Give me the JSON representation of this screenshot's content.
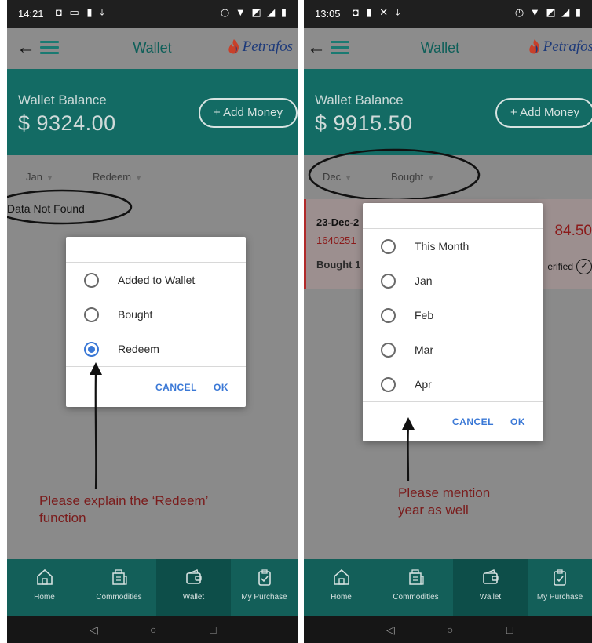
{
  "left": {
    "status": {
      "time": "14:21",
      "icons_left": "◘ ▭ ▮ ⤓",
      "icons_right": "◷ ▼ ◩ ◢ ▮"
    },
    "header": {
      "title": "Wallet",
      "logo": "Petrafos"
    },
    "balance": {
      "label": "Wallet Balance",
      "amount": "$ 9324.00",
      "add_money": "+ Add Money"
    },
    "filters": {
      "month": "Jan",
      "type": "Redeem"
    },
    "empty_message": "Data Not Found",
    "dialog": {
      "options": [
        {
          "label": "Added to Wallet",
          "selected": false
        },
        {
          "label": "Bought",
          "selected": false
        },
        {
          "label": "Redeem",
          "selected": true
        }
      ],
      "cancel": "CANCEL",
      "ok": "OK"
    },
    "note": [
      "Please explain the ‘Redeem’",
      "function"
    ],
    "nav": [
      {
        "label": "Home",
        "icon": "home-icon",
        "active": false
      },
      {
        "label": "Commodities",
        "icon": "commodities-icon",
        "active": false
      },
      {
        "label": "Wallet",
        "icon": "wallet-icon",
        "active": true
      },
      {
        "label": "My Purchase",
        "icon": "clipboard-icon",
        "active": false
      }
    ]
  },
  "right": {
    "status": {
      "time": "13:05",
      "icons_left": "◘ ▮ ✕ ⤓",
      "icons_right": "◷ ▼ ◩ ◢ ▮"
    },
    "header": {
      "title": "Wallet",
      "logo": "Petrafos"
    },
    "balance": {
      "label": "Wallet Balance",
      "amount": "$ 9915.50",
      "add_money": "+ Add Money"
    },
    "filters": {
      "month": "Dec",
      "type": "Bought"
    },
    "transaction": {
      "date": "23-Dec-2",
      "id": "1640251",
      "desc": "Bought 1",
      "amount": "84.50",
      "status": "erified"
    },
    "dialog": {
      "options": [
        {
          "label": "This Month",
          "selected": false
        },
        {
          "label": "Jan",
          "selected": false
        },
        {
          "label": "Feb",
          "selected": false
        },
        {
          "label": "Mar",
          "selected": false
        },
        {
          "label": "Apr",
          "selected": false
        }
      ],
      "cancel": "CANCEL",
      "ok": "OK"
    },
    "note": [
      "Please mention",
      "year as well"
    ],
    "nav": [
      {
        "label": "Home",
        "icon": "home-icon",
        "active": false
      },
      {
        "label": "Commodities",
        "icon": "commodities-icon",
        "active": false
      },
      {
        "label": "Wallet",
        "icon": "wallet-icon",
        "active": true
      },
      {
        "label": "My Purchase",
        "icon": "clipboard-icon",
        "active": false
      }
    ]
  },
  "colors": {
    "teal_dark": "#136b64",
    "nav_bg": "#135f59",
    "accent_blue": "#3a78d6",
    "note_red": "#7a1c1c"
  },
  "icons": {
    "back": "←",
    "caret": "▼",
    "check": "✓",
    "sys_back": "◁",
    "sys_home": "○",
    "sys_recent": "□"
  }
}
